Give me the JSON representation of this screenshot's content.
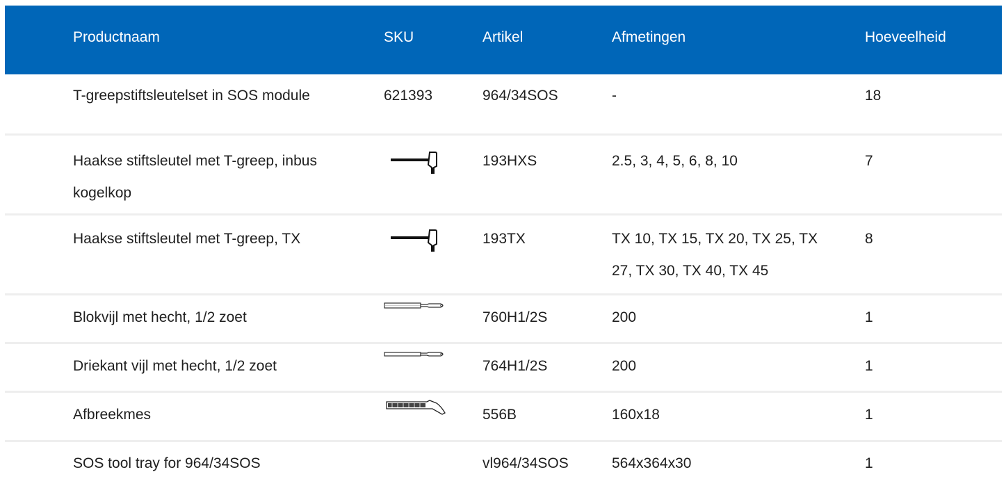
{
  "colors": {
    "header_bg": "#0066b8",
    "header_text": "#ffffff",
    "row_divider": "#eeeeee"
  },
  "table": {
    "headers": [
      "Productnaam",
      "SKU",
      "Artikel",
      "Afmetingen",
      "Hoeveelheid"
    ],
    "rows": [
      {
        "name": "T-greepstiftsleutelset in SOS module",
        "sku": "621393",
        "image": "",
        "artikel": "964/34SOS",
        "afmetingen": "-",
        "hoeveelheid": "18"
      },
      {
        "name": "Haakse stiftsleutel met T-greep, inbus kogelkop",
        "sku": "",
        "image": "t-handle-key-icon",
        "artikel": "193HXS",
        "afmetingen": "2.5, 3, 4, 5, 6, 8, 10",
        "hoeveelheid": "7"
      },
      {
        "name": "Haakse stiftsleutel met T-greep, TX",
        "sku": "",
        "image": "t-handle-key-icon",
        "artikel": "193TX",
        "afmetingen": "TX 10, TX 15, TX 20, TX 25, TX 27, TX 30, TX 40, TX 45",
        "hoeveelheid": "8"
      },
      {
        "name": "Blokvijl met hecht, 1/2 zoet",
        "sku": "",
        "image": "flat-file-icon",
        "artikel": "760H1/2S",
        "afmetingen": "200",
        "hoeveelheid": "1"
      },
      {
        "name": "Driekant vijl met hecht, 1/2 zoet",
        "sku": "",
        "image": "triangular-file-icon",
        "artikel": "764H1/2S",
        "afmetingen": "200",
        "hoeveelheid": "1"
      },
      {
        "name": "Afbreekmes",
        "sku": "",
        "image": "snap-off-knife-icon",
        "artikel": "556B",
        "afmetingen": "160x18",
        "hoeveelheid": "1"
      },
      {
        "name": "SOS tool tray for 964/34SOS",
        "sku": "",
        "image": "",
        "artikel": "vl964/34SOS",
        "afmetingen": "564x364x30",
        "hoeveelheid": "1"
      }
    ]
  }
}
